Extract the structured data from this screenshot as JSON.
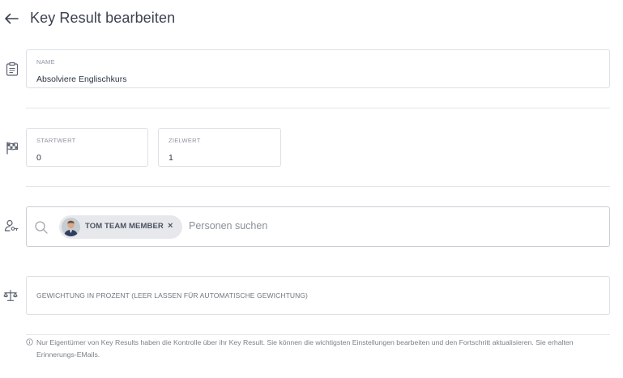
{
  "header": {
    "title": "Key Result bearbeiten"
  },
  "name_field": {
    "label": "NAME",
    "value": "Absolviere Englischkurs"
  },
  "start_field": {
    "label": "STARTWERT",
    "value": "0"
  },
  "target_field": {
    "label": "ZIELWERT",
    "value": "1"
  },
  "people": {
    "chip_label": "TOM TEAM MEMBER",
    "remove_glyph": "×",
    "placeholder": "Personen suchen"
  },
  "weight_field": {
    "placeholder": "GEWICHTUNG IN PROZENT (LEER LASSEN FÜR AUTOMATISCHE GEWICHTUNG)"
  },
  "info": {
    "text": "Nur Eigentümer von Key Results haben die Kontrolle über ihr Key Result. Sie können die wichtigsten Einstellungen bearbeiten und den Fortschritt aktualisieren. Sie erhalten Erinnerungs-EMails."
  },
  "colors": {
    "text": "#2c3545",
    "border": "#dcdfe4",
    "chip": "#e6e8ec",
    "muted": "#8a909a"
  },
  "icons": [
    "back-arrow-icon",
    "clipboard-icon",
    "checkered-flag-icon",
    "user-key-icon",
    "search-icon",
    "balance-scale-icon",
    "info-icon"
  ]
}
